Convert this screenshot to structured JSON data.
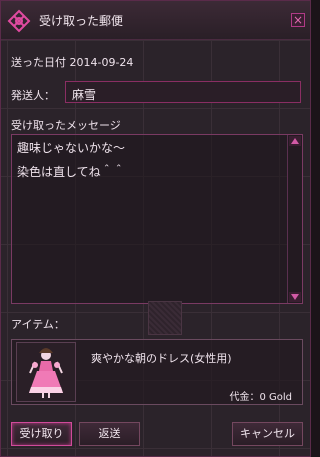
{
  "window": {
    "title": "受け取った郵便",
    "close_label": "×"
  },
  "mail": {
    "sent_date": "送った日付 2014-09-24",
    "sender_label": "発送人：",
    "sender_value": "麻雪",
    "message_label": "受け取ったメッセージ",
    "message_lines": [
      "趣味じゃないかな〜",
      "染色は直してね＾＾"
    ]
  },
  "item": {
    "label": "アイテム：",
    "name": "爽やかな朝のドレス(女性用)",
    "price": "代金：0 Gold"
  },
  "buttons": {
    "receive": "受け取り",
    "return": "返送",
    "cancel": "キャンセル"
  },
  "colors": {
    "accent": "#d04a9a",
    "border": "#8a2e63"
  },
  "icons": {
    "logo": "knot-emblem-icon",
    "item": "pink-dress-icon"
  }
}
